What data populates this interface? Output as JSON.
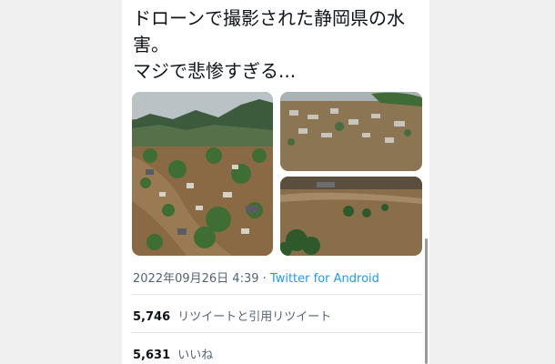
{
  "tweet": {
    "text": "ドローンで撮影された静岡県の水害。\nマジで悲惨すぎる...",
    "photos": [
      {
        "name": "flood-aerial-town-photo"
      },
      {
        "name": "flood-aerial-houses-photo"
      },
      {
        "name": "flood-aerial-river-photo"
      }
    ],
    "timestamp": "2022年09月26日 4:39",
    "separator": "·",
    "source": "Twitter for Android"
  },
  "stats": {
    "retweets": {
      "count": "5,746",
      "label": "リツイートと引用リツイート"
    },
    "likes": {
      "count": "5,631",
      "label": "いいね"
    }
  },
  "colors": {
    "link": "#1d9bf0",
    "text": "#0f1419",
    "muted": "#536471"
  }
}
